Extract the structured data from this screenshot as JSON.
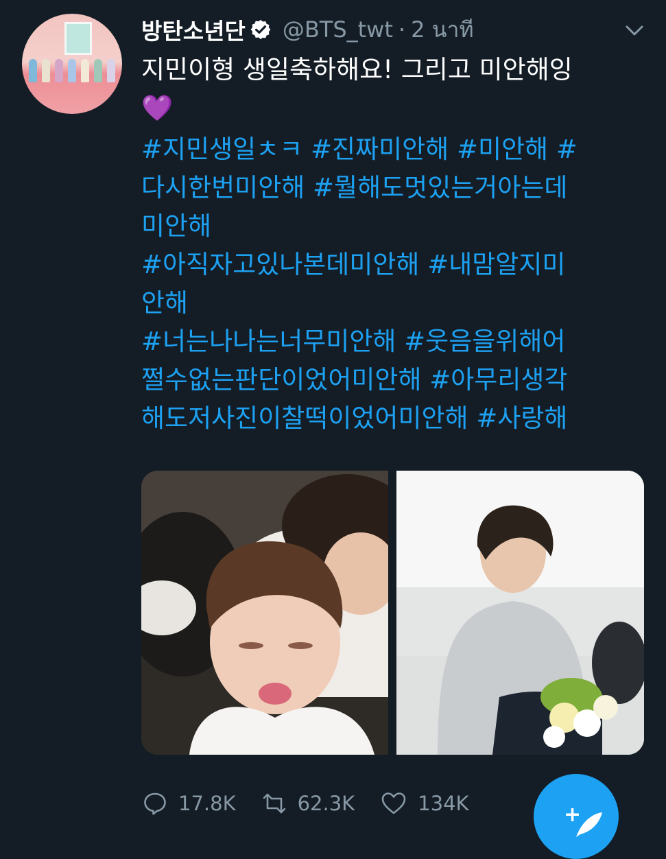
{
  "tweet": {
    "display_name": "방탄소년단",
    "handle": "@BTS_twt",
    "separator": "·",
    "time": "2 นาที",
    "text": "지민이형 생일축하해요! 그리고 미안해잉",
    "emoji": "💜",
    "hashtag_lines": [
      "#지민생일ㅊㅋ #진짜미안해 #미안해 #",
      "다시한번미안해 #뭘해도멋있는거아는데",
      "미안해",
      "#아직자고있나본데미안해 #내맘알지미",
      "안해",
      "#너는나나는너무미안해 #웃음을위해어",
      "쩔수없는판단이었어미안해 #아무리생각",
      "해도저사진이찰떡이었어미안해 #사랑해"
    ]
  },
  "actions": {
    "reply_count": "17.8K",
    "retweet_count": "62.3K",
    "like_count": "134K"
  },
  "compose": {
    "plus_glyph": "+"
  },
  "icons": {
    "verified": "verified-badge-icon",
    "caret": "chevron-down-icon",
    "reply": "reply-icon",
    "retweet": "retweet-icon",
    "like": "heart-icon",
    "compose": "compose-tweet-icon"
  },
  "colors": {
    "background": "#141d26",
    "accent": "#1da1f2",
    "secondary_text": "#8899a6",
    "primary_text": "#ffffff"
  }
}
